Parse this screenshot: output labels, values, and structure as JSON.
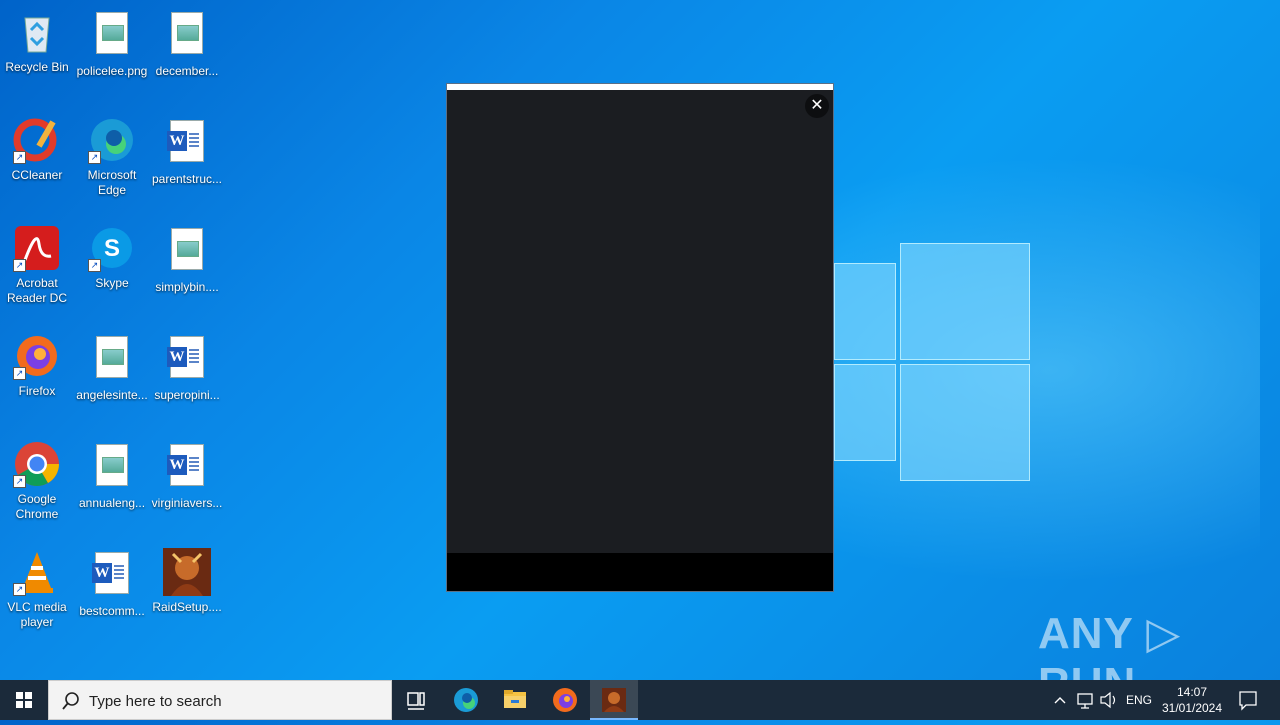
{
  "desktop": {
    "icons": [
      {
        "label": "Recycle Bin"
      },
      {
        "label": "policelee.png"
      },
      {
        "label": "december..."
      },
      {
        "label": "CCleaner"
      },
      {
        "label": "Microsoft Edge"
      },
      {
        "label": "parentstruc..."
      },
      {
        "label": "Acrobat Reader DC"
      },
      {
        "label": "Skype"
      },
      {
        "label": "simplybin...."
      },
      {
        "label": "Firefox"
      },
      {
        "label": "angelesinte..."
      },
      {
        "label": "superopini..."
      },
      {
        "label": "Google Chrome"
      },
      {
        "label": "annualeng..."
      },
      {
        "label": "virginiavers..."
      },
      {
        "label": "VLC media player"
      },
      {
        "label": "bestcomm..."
      },
      {
        "label": "RaidSetup...."
      }
    ]
  },
  "popup": {
    "close_glyph": "✕"
  },
  "watermark": "ANY ▷ RUN",
  "taskbar": {
    "search_placeholder": "Type here to search",
    "tray_language": "ENG",
    "clock_time": "14:07",
    "clock_date": "31/01/2024"
  },
  "colors": {
    "popup_bg": "#1b1d21",
    "taskbar_bg": "#1b2a3a",
    "desktop_accent": "#0a86e6"
  }
}
